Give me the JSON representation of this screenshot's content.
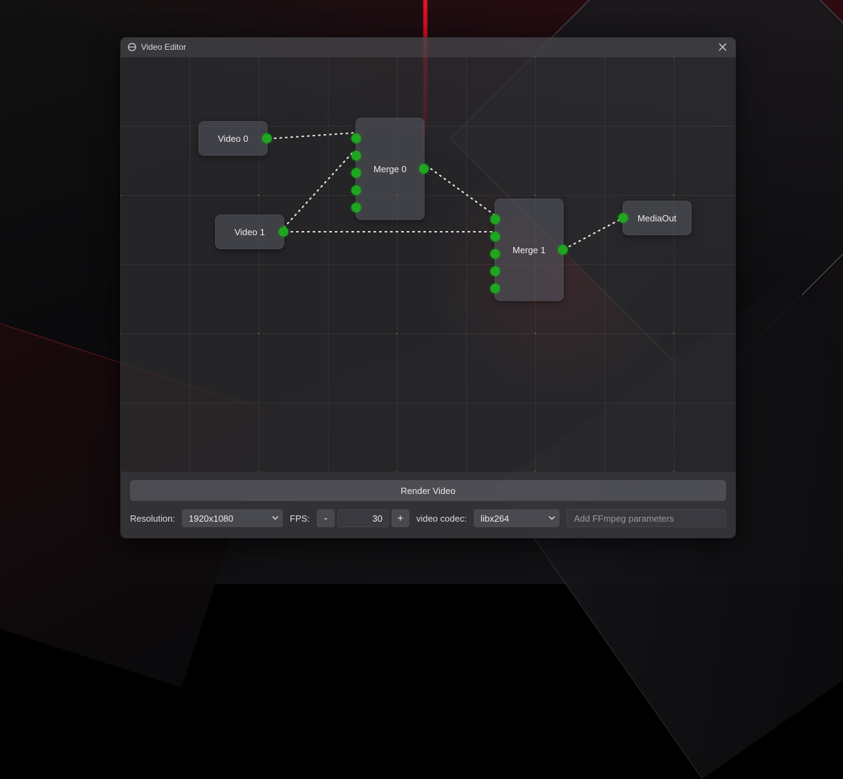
{
  "window": {
    "title": "Video Editor"
  },
  "nodes": {
    "video0": {
      "label": "Video 0"
    },
    "video1": {
      "label": "Video 1"
    },
    "merge0": {
      "label": "Merge 0"
    },
    "merge1": {
      "label": "Merge 1"
    },
    "mediaout": {
      "label": "MediaOut"
    }
  },
  "footer": {
    "render_label": "Render Video",
    "resolution_label": "Resolution:",
    "resolution_value": "1920x1080",
    "fps_label": "FPS:",
    "fps_minus": "-",
    "fps_plus": "+",
    "fps_value": "30",
    "codec_label": "video codec:",
    "codec_value": "libx264",
    "params_placeholder": "Add FFmpeg parameters"
  }
}
